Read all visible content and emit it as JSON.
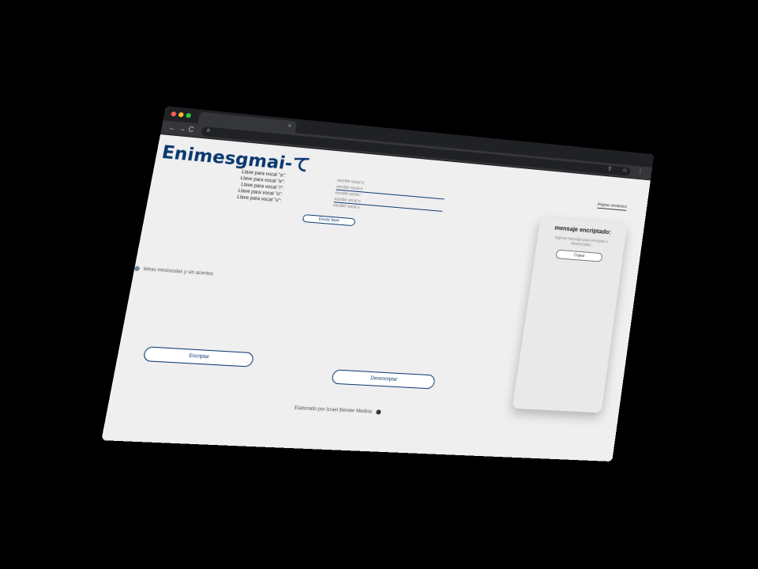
{
  "browser": {
    "tab_close": "×",
    "nav_back": "←",
    "nav_forward": "→",
    "nav_reload": "C",
    "lock": "a",
    "toolbar_icons": "⇪ ☆ ⋮"
  },
  "app": {
    "logo": "Enimesgmai-て",
    "keys": {
      "labels": [
        "Llave para vocal \"a\":",
        "Llave para vocal \"e\":",
        "Llave para vocal \"i\":",
        "Llave para vocal \"o\":",
        "Llave para vocal \"u\":"
      ],
      "inputs": [
        "escribir vocal a",
        "escribir vocal e",
        "escribir vocal i",
        "escribir vocal o",
        "escribir vocal u"
      ],
      "send_label": "Enviar llave"
    },
    "assign_label": "Asignar semántico",
    "hint": "letras minúsculas y sin acentos",
    "encrypt_label": "Encriptar",
    "decrypt_label": "Desencriptar",
    "footer": "Elaborado por Izrael Bender Medina",
    "result": {
      "title": "mensaje encriptado:",
      "text": "Ingrese mensaje para encriptar o desencriptar",
      "copy_label": "Copiar"
    }
  }
}
